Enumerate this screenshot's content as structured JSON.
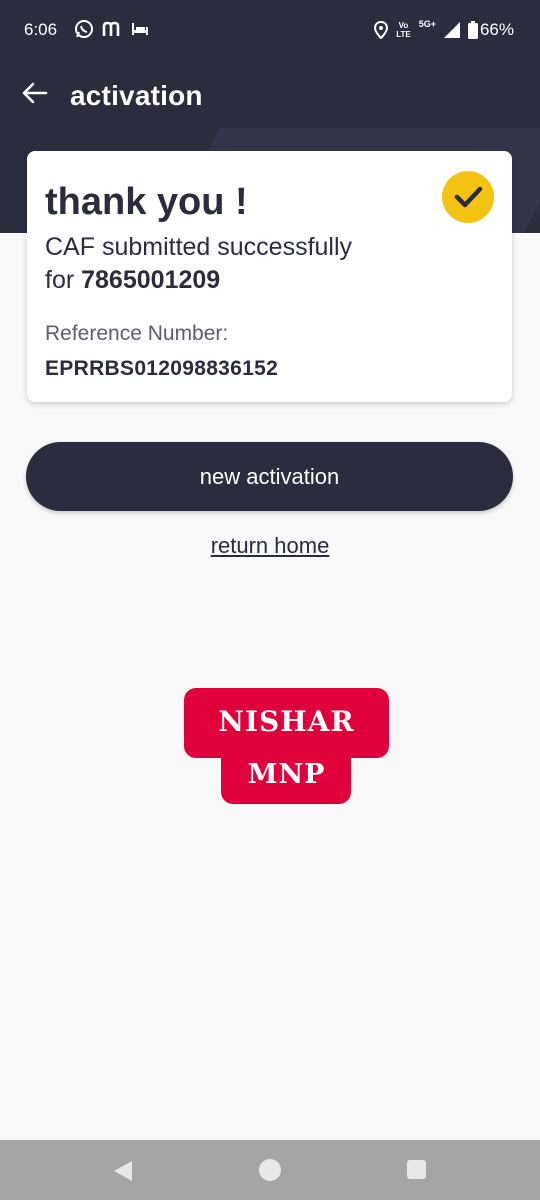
{
  "status_bar": {
    "time": "6:06",
    "left_icons": [
      "whatsapp-icon",
      "m-app-icon",
      "hotel-bed-icon"
    ],
    "carrier_top": "Vo",
    "carrier_bottom": "LTE",
    "network": "5G+",
    "battery": "66%"
  },
  "header": {
    "title": "activation",
    "back_icon": "arrow-left-icon"
  },
  "confirmation": {
    "heading": "thank you !",
    "message": "CAF submitted successfully",
    "for_prefix": "for ",
    "mobile_number": "7865001209",
    "reference_label": "Reference Number:",
    "reference_number": "EPRRBS012098836152",
    "status_icon": "check-circle-icon"
  },
  "actions": {
    "primary_label": "new activation",
    "secondary_label": "return home"
  },
  "logo": {
    "line1": "NISHAR",
    "line2": "MNP"
  },
  "nav": {
    "icons": [
      "back-triangle-icon",
      "home-circle-icon",
      "recents-square-icon"
    ]
  },
  "colors": {
    "primary": "#2b2c3e",
    "accent": "#f5c314",
    "logo": "#e0003c",
    "background": "#f9f9f9"
  }
}
